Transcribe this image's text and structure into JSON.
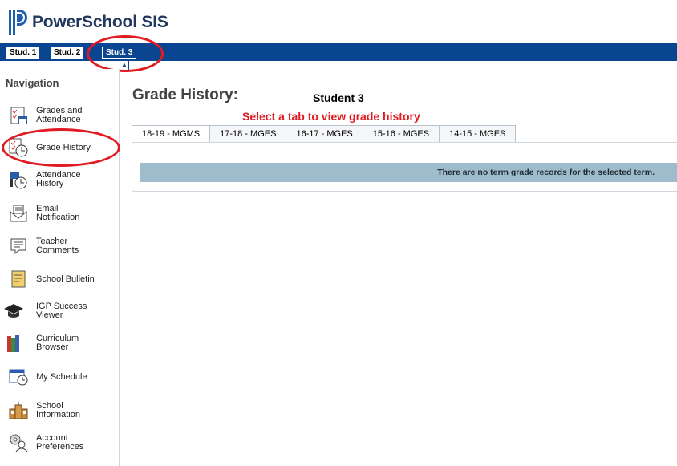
{
  "app": {
    "title": "PowerSchool SIS"
  },
  "student_tabs": [
    {
      "label": "Stud. 1",
      "active": false
    },
    {
      "label": "Stud. 2",
      "active": false
    },
    {
      "label": "Stud. 3",
      "active": true
    }
  ],
  "sidebar": {
    "heading": "Navigation",
    "items": [
      {
        "label": [
          "Grades and",
          "Attendance"
        ],
        "icon": "grades-attendance-icon"
      },
      {
        "label": [
          "Grade History"
        ],
        "icon": "grade-history-icon"
      },
      {
        "label": [
          "Attendance",
          "History"
        ],
        "icon": "attendance-history-icon"
      },
      {
        "label": [
          "Email",
          "Notification"
        ],
        "icon": "email-notification-icon"
      },
      {
        "label": [
          "Teacher",
          "Comments"
        ],
        "icon": "teacher-comments-icon"
      },
      {
        "label": [
          "School Bulletin"
        ],
        "icon": "school-bulletin-icon"
      },
      {
        "label": [
          "IGP Success",
          "Viewer"
        ],
        "icon": "graduation-cap-icon"
      },
      {
        "label": [
          "Curriculum",
          "Browser"
        ],
        "icon": "books-icon"
      },
      {
        "label": [
          "My Schedule"
        ],
        "icon": "schedule-icon"
      },
      {
        "label": [
          "School",
          "Information"
        ],
        "icon": "school-building-icon"
      },
      {
        "label": [
          "Account",
          "Preferences"
        ],
        "icon": "account-preferences-icon"
      }
    ]
  },
  "main": {
    "title": "Grade History:",
    "student": "Student 3",
    "instruction": "Select a tab to view grade history",
    "term_tabs": [
      "18-19 - MGMS",
      "17-18 - MGES",
      "16-17 - MGES",
      "15-16 - MGES",
      "14-15 - MGES"
    ],
    "empty_message": "There are no term grade records for the selected term."
  },
  "colors": {
    "topbar": "#0a4591",
    "callout": "#e11b22",
    "instruction": "#e11b22",
    "empty_bar": "#9fbccc"
  }
}
